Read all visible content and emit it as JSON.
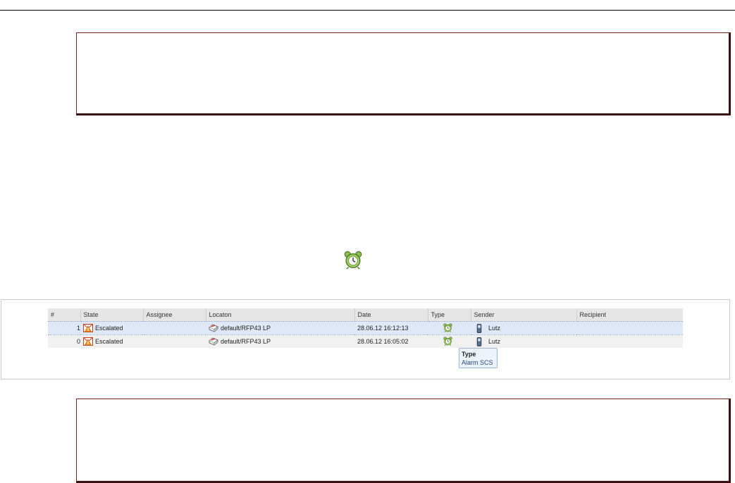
{
  "table": {
    "columns": [
      "#",
      "State",
      "Assignee",
      "Locaton",
      "Date",
      "Type",
      "Sender",
      "Recipient"
    ],
    "rows": [
      {
        "num": "1",
        "state": "Escalated",
        "assignee": "",
        "location": "default/RFP43 LP",
        "date": "28.06.12 16:12:13",
        "type_icon": "alarm-clock-icon",
        "sender": "Lutz",
        "recipient": ""
      },
      {
        "num": "0",
        "state": "Escalated",
        "assignee": "",
        "location": "default/RFP43 LP",
        "date": "28.06.12 16:05:02",
        "type_icon": "alarm-clock-icon",
        "sender": "Lutz",
        "recipient": ""
      }
    ]
  },
  "tooltip": {
    "title": "Type",
    "body": "Alarm SCS"
  },
  "colors": {
    "box_border": "#7a1f1f",
    "selected_row": "#dfe8f6",
    "header_bg": "#e6e6e6"
  }
}
